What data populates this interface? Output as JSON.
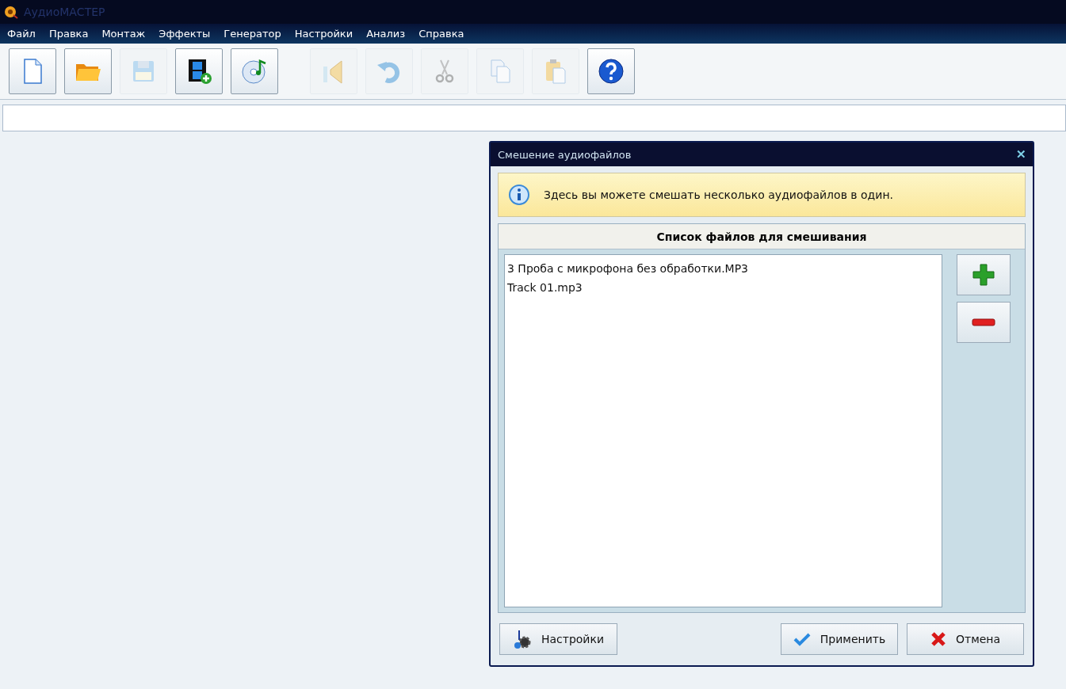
{
  "window": {
    "title": "АудиоМАСТЕР"
  },
  "menu": [
    "Файл",
    "Правка",
    "Монтаж",
    "Эффекты",
    "Генератор",
    "Настройки",
    "Анализ",
    "Справка"
  ],
  "toolbar": [
    [
      {
        "kind": "new",
        "disabled": false
      },
      {
        "kind": "open",
        "disabled": false
      },
      {
        "kind": "save",
        "disabled": true
      },
      {
        "kind": "video",
        "disabled": false
      },
      {
        "kind": "disc",
        "disabled": false
      }
    ],
    [
      {
        "kind": "speaker",
        "disabled": true
      },
      {
        "kind": "undo",
        "disabled": true
      },
      {
        "kind": "cut",
        "disabled": true
      },
      {
        "kind": "copy",
        "disabled": true
      },
      {
        "kind": "paste",
        "disabled": true
      },
      {
        "kind": "help",
        "disabled": false
      }
    ]
  ],
  "dialog": {
    "title": "Смешение аудиофайлов",
    "close": "✕",
    "info": "Здесь вы можете смешать несколько аудиофайлов в один.",
    "list_header": "Список файлов для смешивания",
    "files": [
      "3 Проба с микрофона без обработки.MP3",
      "Track 01.mp3"
    ],
    "buttons": [
      {
        "kind": "settings",
        "label": "Настройки"
      },
      {
        "kind": "apply",
        "label": "Применить"
      },
      {
        "kind": "cancel",
        "label": "Отмена"
      }
    ]
  }
}
